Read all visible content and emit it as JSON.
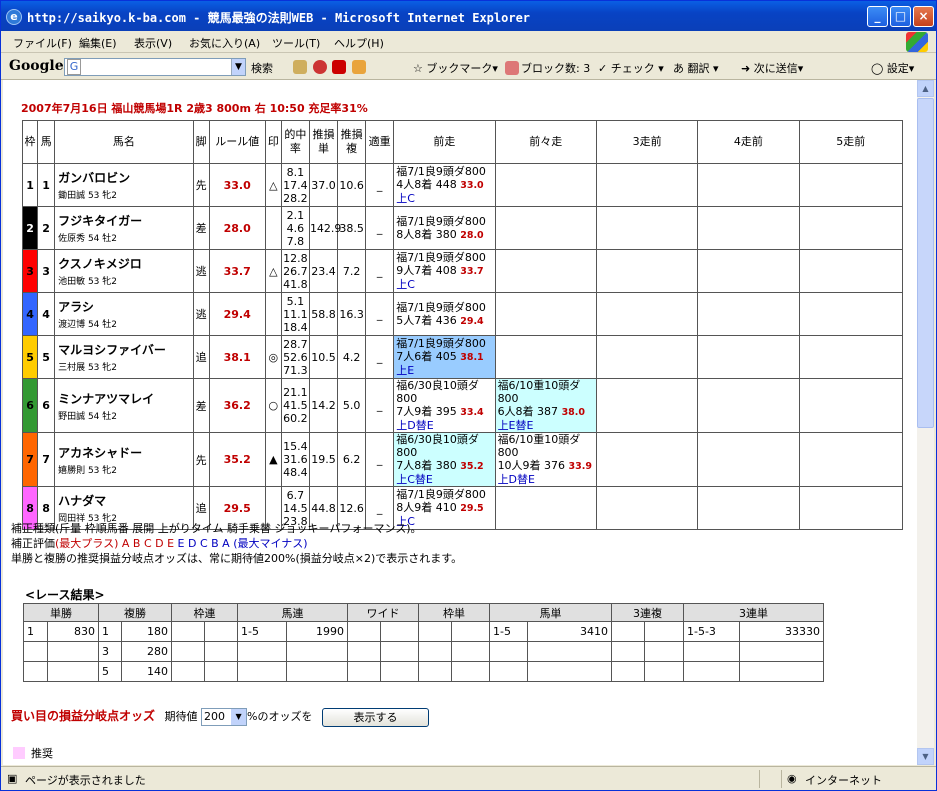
{
  "window": {
    "title": "http://saikyo.k-ba.com - 競馬最強の法則WEB - Microsoft Internet Explorer"
  },
  "menu": [
    "ファイル(F)",
    "編集(E)",
    "表示(V)",
    "お気に入り(A)",
    "ツール(T)",
    "ヘルプ(H)"
  ],
  "google_bar": {
    "logo": "Google",
    "search_label": "検索",
    "bookmarks": "ブックマーク▾",
    "blocked": "ブロック数: 3",
    "check": "チェック",
    "translate": "翻訳",
    "send": "次に送信▾",
    "settings": "設定▾"
  },
  "race": {
    "title": "2007年7月16日 福山競馬場1R 2歳3 800m 右 10:50 充足率31%"
  },
  "table_headers": {
    "waku": "枠",
    "uma": "馬",
    "name": "馬名",
    "leg": "脚",
    "rule": "ルール値",
    "mark": "印",
    "hit": "的中率",
    "win": "推損単",
    "place": "推損複",
    "fit": "適重",
    "prev1": "前走",
    "prev2": "前々走",
    "prev3": "3走前",
    "prev4": "4走前",
    "prev5": "5走前"
  },
  "entries": [
    {
      "waku": "1",
      "uma": "1",
      "name": "ガンバロビン",
      "jockey": "鋤田誠 53 牝2",
      "leg": "先",
      "rule": "33.0",
      "mark": "△",
      "hit": [
        "8.1",
        "17.4",
        "28.2"
      ],
      "win": "37.0",
      "place": "10.6",
      "fit": "_",
      "color": "#ffffff",
      "text": "#000000",
      "prev1": {
        "l1": "福7/1良9頭ダ800",
        "l2": "4人8着 448 ",
        "v": "33.0",
        "l3": "上C",
        "bg": "#ffffff"
      },
      "prev2": null
    },
    {
      "waku": "2",
      "uma": "2",
      "name": "フジキタイガー",
      "jockey": "佐原秀 54 牡2",
      "leg": "差",
      "rule": "28.0",
      "mark": "",
      "hit": [
        "2.1",
        "4.6",
        "7.8"
      ],
      "win": "142.9",
      "place": "38.5",
      "fit": "_",
      "color": "#000000",
      "text": "#ffffff",
      "prev1": {
        "l1": "福7/1良9頭ダ800",
        "l2": "8人8着 380 ",
        "v": "28.0",
        "l3": "",
        "bg": "#ffffff"
      },
      "prev2": null
    },
    {
      "waku": "3",
      "uma": "3",
      "name": "クスノキメジロ",
      "jockey": "池田敏 53 牝2",
      "leg": "逃",
      "rule": "33.7",
      "mark": "△",
      "hit": [
        "12.8",
        "26.7",
        "41.8"
      ],
      "win": "23.4",
      "place": "7.2",
      "fit": "_",
      "color": "#ff0000",
      "text": "#000000",
      "prev1": {
        "l1": "福7/1良9頭ダ800",
        "l2": "9人7着 408 ",
        "v": "33.7",
        "l3": "上C",
        "bg": "#ffffff"
      },
      "prev2": null
    },
    {
      "waku": "4",
      "uma": "4",
      "name": "アラシ",
      "jockey": "渡辺博 54 牡2",
      "leg": "逃",
      "rule": "29.4",
      "mark": "",
      "hit": [
        "5.1",
        "11.1",
        "18.4"
      ],
      "win": "58.8",
      "place": "16.3",
      "fit": "_",
      "color": "#3366ff",
      "text": "#000000",
      "prev1": {
        "l1": "福7/1良9頭ダ800",
        "l2": "5人7着 436 ",
        "v": "29.4",
        "l3": "",
        "bg": "#ffffff"
      },
      "prev2": null
    },
    {
      "waku": "5",
      "uma": "5",
      "name": "マルヨシファイバー",
      "jockey": "三村展 53 牝2",
      "leg": "追",
      "rule": "38.1",
      "mark": "◎",
      "hit": [
        "28.7",
        "52.6",
        "71.3"
      ],
      "win": "10.5",
      "place": "4.2",
      "fit": "_",
      "color": "#ffcc00",
      "text": "#000000",
      "prev1": {
        "l1": "福7/1良9頭ダ800",
        "l2": "7人6着 405 ",
        "v": "38.1",
        "l3": "上E",
        "bg": "#99ccff"
      },
      "prev2": null
    },
    {
      "waku": "6",
      "uma": "6",
      "name": "ミンナアツマレイ",
      "jockey": "野田誠 54 牡2",
      "leg": "差",
      "rule": "36.2",
      "mark": "○",
      "hit": [
        "21.1",
        "41.5",
        "60.2"
      ],
      "win": "14.2",
      "place": "5.0",
      "fit": "_",
      "color": "#339933",
      "text": "#000000",
      "prev1": {
        "l1": "福6/30良10頭ダ800",
        "l2": "7人9着 395 ",
        "v": "33.4",
        "l3": "上D替E",
        "bg": "#ffffff"
      },
      "prev2": {
        "l1": "福6/10重10頭ダ800",
        "l2": "6人8着 387 ",
        "v": "38.0",
        "l3": "上E替E",
        "bg": "#ccffff"
      }
    },
    {
      "waku": "7",
      "uma": "7",
      "name": "アカネシャドー",
      "jockey": "嬉勝則 53 牝2",
      "leg": "先",
      "rule": "35.2",
      "mark": "▲",
      "hit": [
        "15.4",
        "31.6",
        "48.4"
      ],
      "win": "19.5",
      "place": "6.2",
      "fit": "_",
      "color": "#ff6600",
      "text": "#000000",
      "prev1": {
        "l1": "福6/30良10頭ダ800",
        "l2": "7人8着 380 ",
        "v": "35.2",
        "l3": "上C替E",
        "bg": "#ccffff"
      },
      "prev2": {
        "l1": "福6/10重10頭ダ800",
        "l2": "10人9着 376 ",
        "v": "33.9",
        "l3": "上D替E",
        "bg": "#ffffff"
      }
    },
    {
      "waku": "8",
      "uma": "8",
      "name": "ハナダマ",
      "jockey": "岡田祥 53 牝2",
      "leg": "追",
      "rule": "29.5",
      "mark": "",
      "hit": [
        "6.7",
        "14.5",
        "23.8"
      ],
      "win": "44.8",
      "place": "12.6",
      "fit": "_",
      "color": "#ff66ff",
      "text": "#000000",
      "prev1": {
        "l1": "福7/1良9頭ダ800",
        "l2": "8人9着 410 ",
        "v": "29.5",
        "l3": "上C",
        "bg": "#ffffff"
      },
      "prev2": null
    }
  ],
  "legend": {
    "line1": "補正種類(斤量 枠順馬番 展開 上がりタイム 騎手乗替 ジョッキーパフォーマンス)。",
    "line2_prefix": "補正評価",
    "line2_max_plus": "(最大プラス)",
    "line2_red": "A B C D E",
    "line2_blue": "E D C B A",
    "line2_max_minus": "(最大マイナス)",
    "line3": "単勝と複勝の推奨損益分岐点オッズは、常に期待値200%(損益分岐点×2)で表示されます。"
  },
  "results": {
    "title": "<レース結果>",
    "headers": [
      "単勝",
      "複勝",
      "枠連",
      "馬連",
      "ワイド",
      "枠単",
      "馬単",
      "3連複",
      "3連単"
    ],
    "rows": [
      [
        "1",
        "830",
        "1",
        "180",
        "",
        "",
        "1-5",
        "1990",
        "",
        "",
        "",
        "",
        "1-5",
        "3410",
        "",
        "",
        "1-5-3",
        "33330"
      ],
      [
        "",
        "",
        "3",
        "280",
        "",
        "",
        "",
        "",
        "",
        "",
        "",
        "",
        "",
        "",
        "",
        "",
        "",
        ""
      ],
      [
        "",
        "",
        "5",
        "140",
        "",
        "",
        "",
        "",
        "",
        "",
        "",
        "",
        "",
        "",
        "",
        "",
        "",
        ""
      ]
    ]
  },
  "odds": {
    "label": "買い目の損益分岐点オッズ",
    "expect": "期待値",
    "value": "200",
    "suffix": "%のオッズを",
    "button": "表示する"
  },
  "recommend": "推奨",
  "status": {
    "left": "ページが表示されました",
    "right": "インターネット"
  }
}
